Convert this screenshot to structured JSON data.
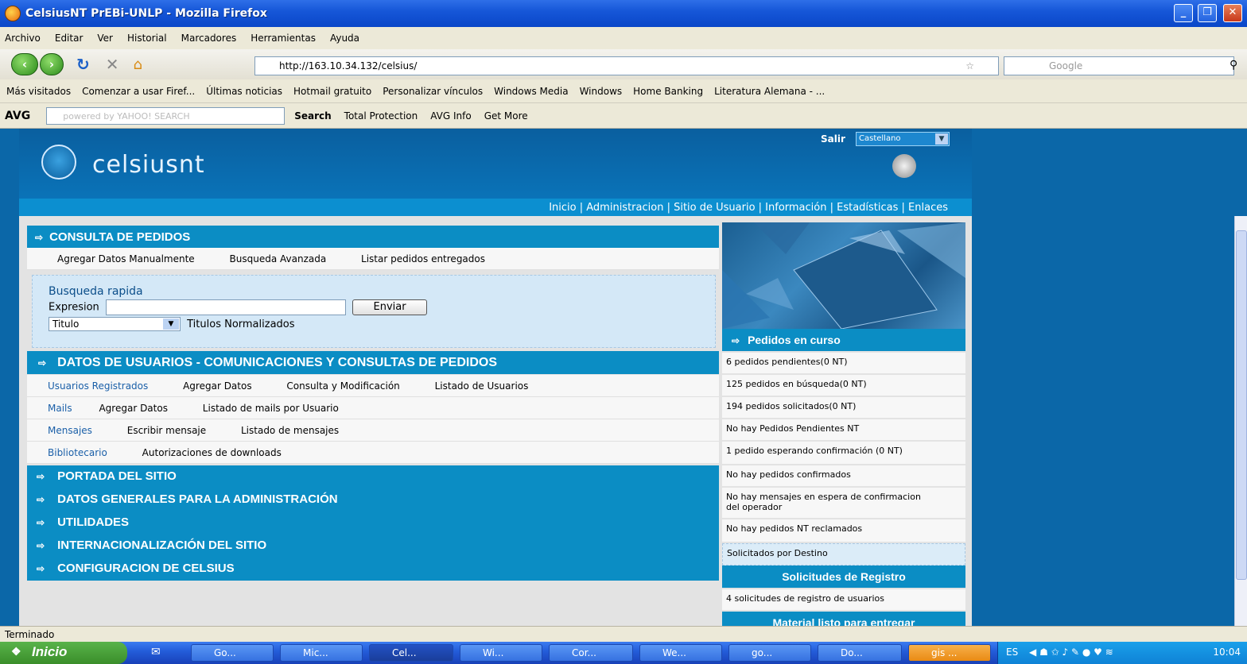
{
  "window": {
    "title": "CelsiusNT PrEBi-UNLP - Mozilla Firefox"
  },
  "menu": [
    "Archivo",
    "Editar",
    "Ver",
    "Historial",
    "Marcadores",
    "Herramientas",
    "Ayuda"
  ],
  "nav": {
    "url": "http://163.10.34.132/celsius/",
    "search_placeholder": "Google"
  },
  "bookmarks": [
    "Más visitados",
    "Comenzar a usar Firef...",
    "Últimas noticias",
    "Hotmail gratuito",
    "Personalizar vínculos",
    "Windows Media",
    "Windows",
    "Home Banking",
    "Literatura Alemana - ..."
  ],
  "avg": {
    "logo": "AVG",
    "yahoo": "powered by YAHOO! SEARCH",
    "search": "Search",
    "total_protection": "Total Protection",
    "avg_info": "AVG Info",
    "get_more": "Get More"
  },
  "header": {
    "brand": "celsiusnt",
    "salir": "Salir",
    "language": "Castellano"
  },
  "topnav": "Inicio | Administracion | Sitio de Usuario | Información | Estadísticas | Enlaces",
  "consulta": {
    "title": "CONSULTA DE PEDIDOS",
    "links": [
      "Agregar Datos Manualmente",
      "Busqueda Avanzada",
      "Listar pedidos entregados"
    ],
    "quick_title": "Busqueda rapida",
    "expr_label": "Expresion",
    "submit": "Enviar",
    "select_value": "Titulo",
    "normalized": "Titulos Normalizados"
  },
  "datos": {
    "title": "DATOS DE USUARIOS - COMUNICACIONES Y CONSULTAS DE PEDIDOS",
    "rows": [
      {
        "head": "Usuarios Registrados",
        "links": [
          "Agregar Datos",
          "Consulta y Modificación",
          "Listado de Usuarios"
        ]
      },
      {
        "head": "Mails",
        "links": [
          "Agregar Datos",
          "Listado de mails por Usuario"
        ]
      },
      {
        "head": "Mensajes",
        "links": [
          "Escribir mensaje",
          "Listado de mensajes"
        ]
      },
      {
        "head": "Bibliotecario",
        "links": [
          "Autorizaciones de downloads"
        ]
      }
    ]
  },
  "menus": [
    "PORTADA DEL SITIO",
    "DATOS GENERALES PARA LA ADMINISTRACIÓN",
    "UTILIDADES",
    "INTERNACIONALIZACIÓN DEL SITIO",
    "CONFIGURACION DE CELSIUS"
  ],
  "right": {
    "pedidos_title": "Pedidos en curso",
    "pedidos": [
      "6 pedidos pendientes(0 NT)",
      "125 pedidos en búsqueda(0 NT)",
      "194 pedidos solicitados(0 NT)",
      "No hay Pedidos Pendientes NT",
      "1 pedido esperando confirmación (0 NT)",
      "No hay pedidos confirmados",
      "No hay mensajes en espera de confirmacion del operador",
      "No hay pedidos NT reclamados",
      "Solicitados por Destino"
    ],
    "solicitudes_title": "Solicitudes de Registro",
    "solicitudes": [
      "4 solicitudes de registro de usuarios"
    ],
    "material_title": "Material listo para entregar"
  },
  "status": "Terminado",
  "taskbar": {
    "start": "Inicio",
    "buttons": [
      "Go...",
      "Mic...",
      "Cel...",
      "Wi...",
      "Cor...",
      "We...",
      "go...",
      "Do...",
      "gis ..."
    ],
    "lang": "ES",
    "clock": "10:04"
  }
}
